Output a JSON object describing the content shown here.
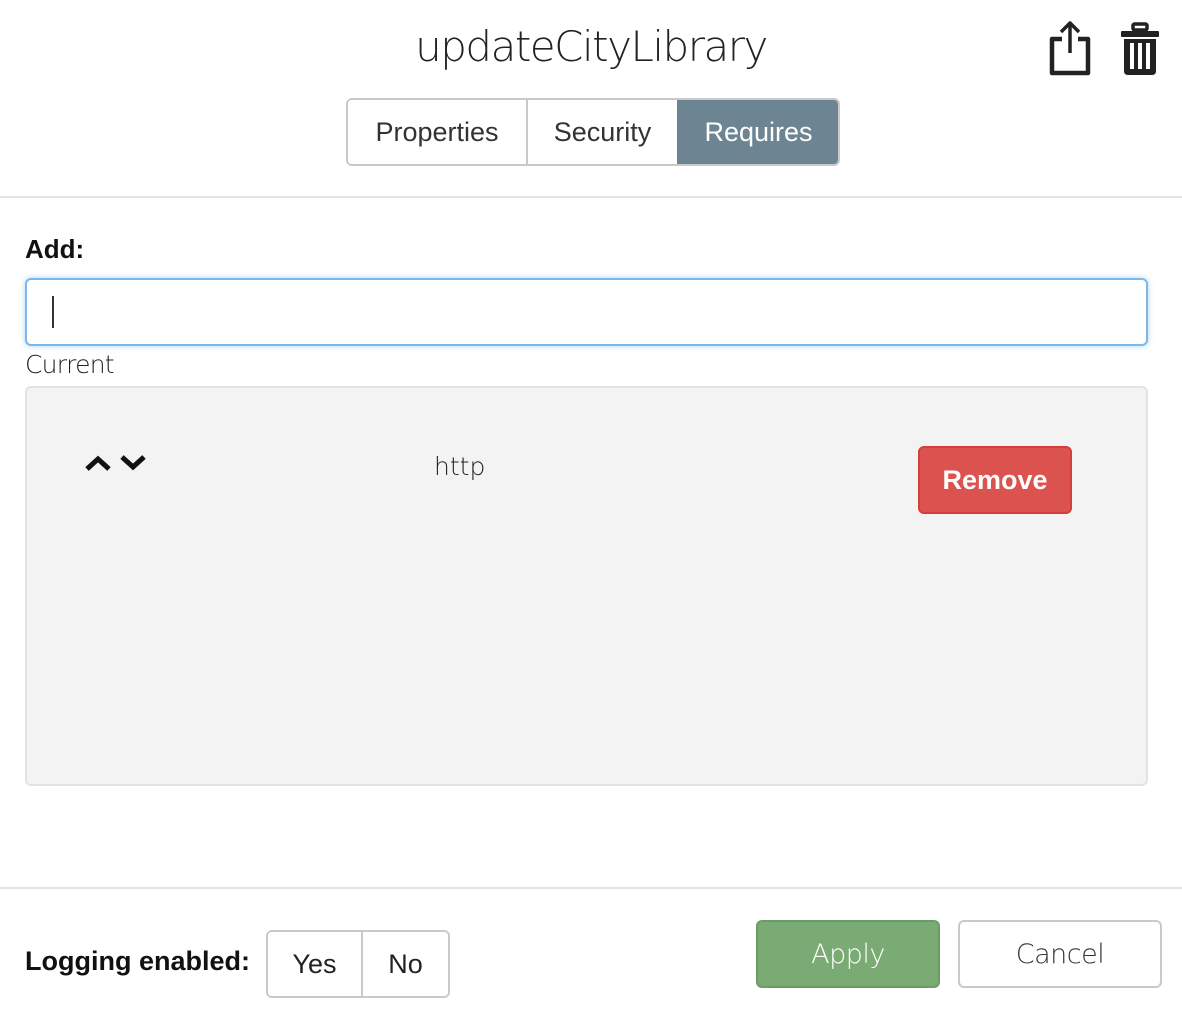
{
  "header": {
    "title": "updateCityLibrary",
    "actions": [
      {
        "icon": "share-icon"
      },
      {
        "icon": "trash-icon"
      }
    ]
  },
  "tabs": [
    {
      "label": "Properties",
      "active": false
    },
    {
      "label": "Security",
      "active": false
    },
    {
      "label": "Requires",
      "active": true
    }
  ],
  "add": {
    "label": "Add:",
    "value": "",
    "placeholder": ""
  },
  "current": {
    "label": "Current",
    "items": [
      {
        "name": "http",
        "remove_label": "Remove",
        "move_up_icon": "chevron-up-icon",
        "move_down_icon": "chevron-down-icon"
      }
    ]
  },
  "footer": {
    "logging_label": "Logging enabled:",
    "logging_options": [
      "Yes",
      "No"
    ],
    "apply_label": "Apply",
    "cancel_label": "Cancel"
  },
  "colors": {
    "active_tab": "#6d8593",
    "remove": "#dc524e",
    "apply": "#7aab74",
    "input_focus": "#7fb8e8"
  }
}
